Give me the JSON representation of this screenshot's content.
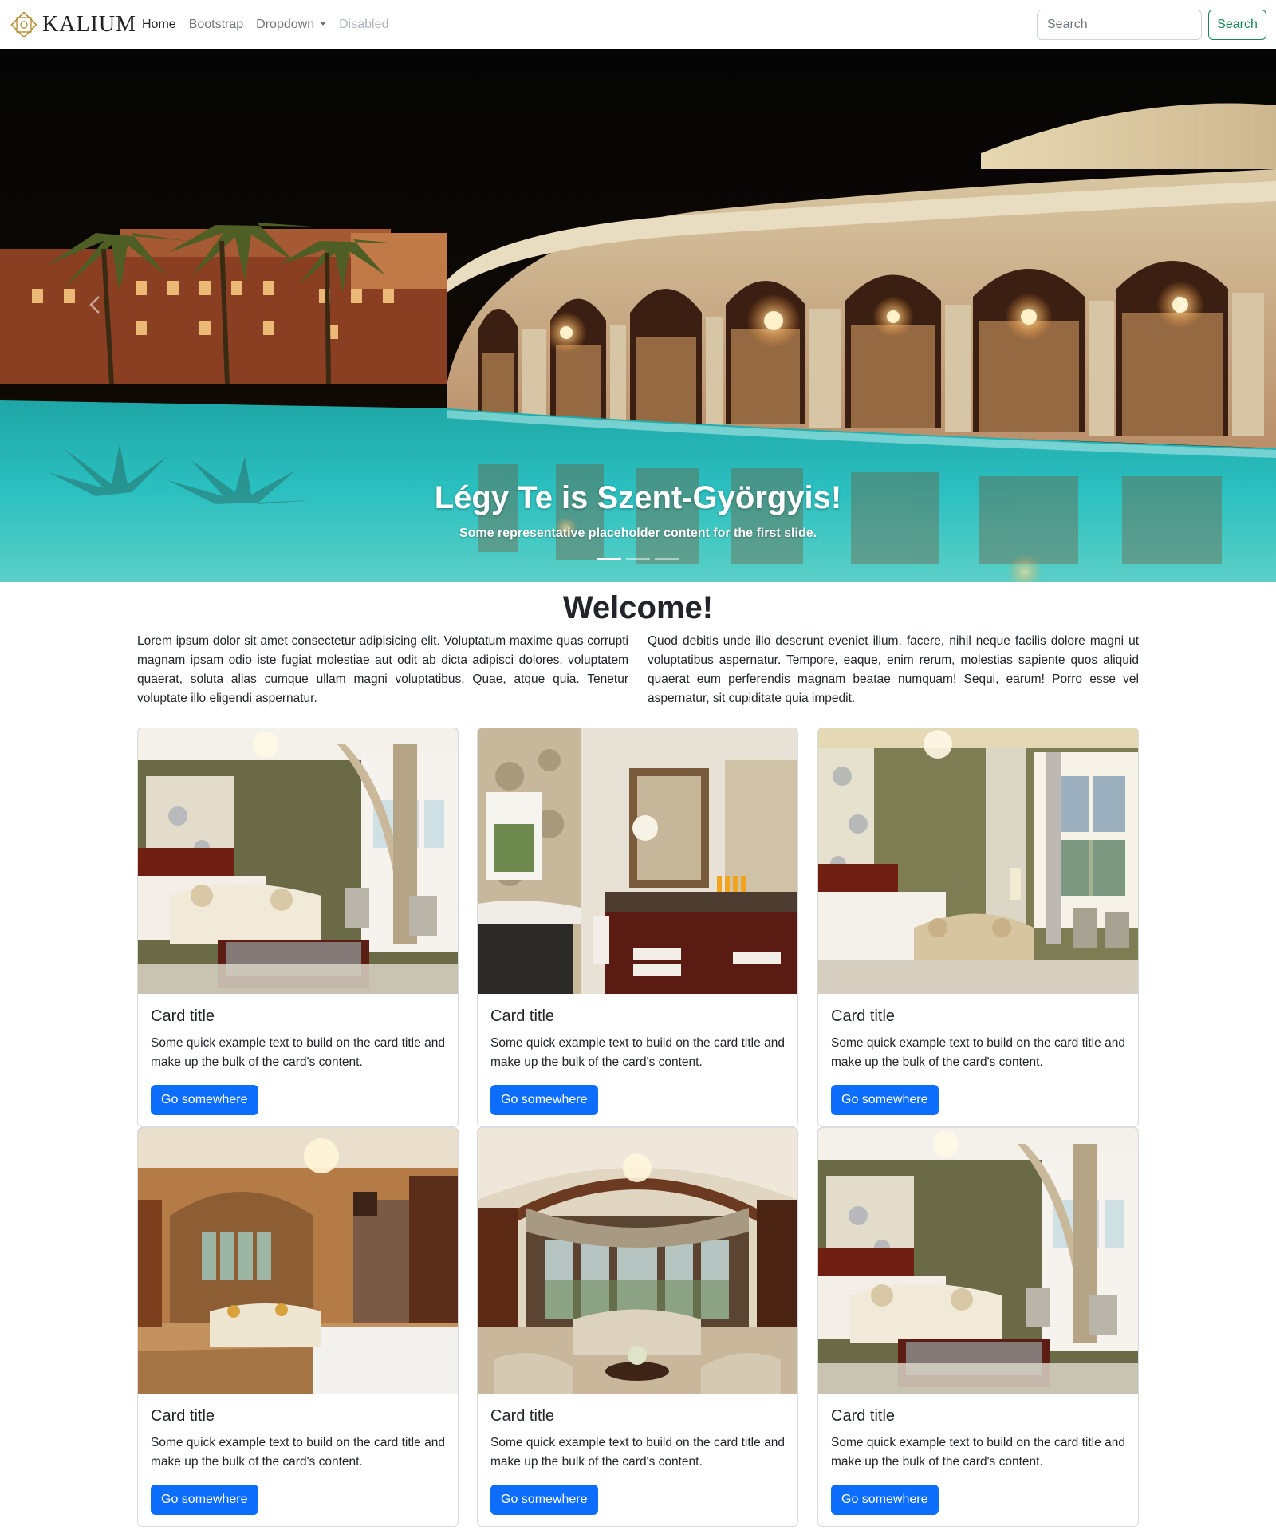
{
  "navbar": {
    "brand": "KALIUM",
    "links": {
      "home": "Home",
      "bootstrap": "Bootstrap",
      "dropdown": "Dropdown",
      "disabled": "Disabled"
    },
    "search_placeholder": "Search",
    "search_button": "Search"
  },
  "carousel": {
    "title": "Légy Te is Szent-Györgyis!",
    "text": "Some representative placeholder content for the first slide.",
    "slide_count": 3,
    "active_slide": 1
  },
  "welcome": {
    "title": "Welcome!",
    "paragraph_left": "Lorem ipsum dolor sit amet consectetur adipisicing elit. Voluptatum maxime quas corrupti magnam ipsam odio iste fugiat molestiae aut odit ab dicta adipisci dolores, voluptatem quaerat, soluta alias cumque ullam magni voluptatibus. Quae, atque quia. Tenetur voluptate illo eligendi aspernatur.",
    "paragraph_right": "Quod debitis unde illo deserunt eveniet illum, facere, nihil neque facilis dolore magni ut voluptatibus aspernatur. Tempore, eaque, enim rerum, molestias sapiente quos aliquid quaerat eum perferendis magnam beatae numquam! Sequi, earum! Porro esse vel aspernatur, sit cupiditate quia impedit."
  },
  "cards": [
    {
      "title": "Card title",
      "text": "Some quick example text to build on the card title and make up the bulk of the card's content.",
      "button": "Go somewhere"
    },
    {
      "title": "Card title",
      "text": "Some quick example text to build on the card title and make up the bulk of the card's content.",
      "button": "Go somewhere"
    },
    {
      "title": "Card title",
      "text": "Some quick example text to build on the card title and make up the bulk of the card's content.",
      "button": "Go somewhere"
    },
    {
      "title": "Card title",
      "text": "Some quick example text to build on the card title and make up the bulk of the card's content.",
      "button": "Go somewhere"
    },
    {
      "title": "Card title",
      "text": "Some quick example text to build on the card title and make up the bulk of the card's content.",
      "button": "Go somewhere"
    },
    {
      "title": "Card title",
      "text": "Some quick example text to build on the card title and make up the bulk of the card's content.",
      "button": "Go somewhere"
    }
  ],
  "colors": {
    "primary": "#0d6efd",
    "success": "#198754",
    "brand_gold": "#b8923a"
  }
}
